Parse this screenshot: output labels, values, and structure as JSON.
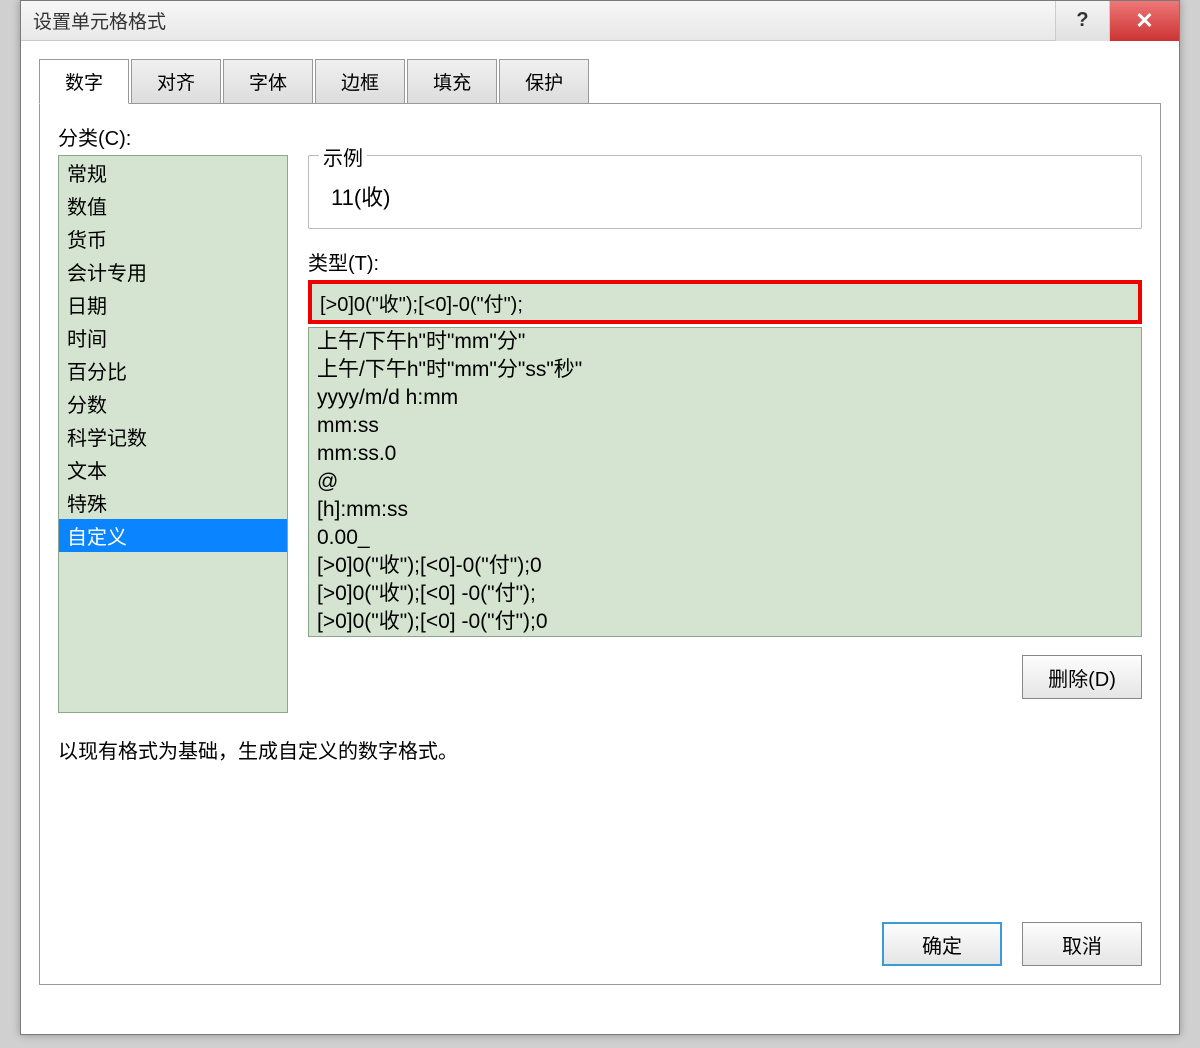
{
  "window": {
    "title": "设置单元格格式",
    "help_icon": "?",
    "close_icon": "✕"
  },
  "tabs": [
    "数字",
    "对齐",
    "字体",
    "边框",
    "填充",
    "保护"
  ],
  "active_tab_index": 0,
  "category_label": "分类(C):",
  "categories": [
    "常规",
    "数值",
    "货币",
    "会计专用",
    "日期",
    "时间",
    "百分比",
    "分数",
    "科学记数",
    "文本",
    "特殊",
    "自定义"
  ],
  "selected_category_index": 11,
  "sample": {
    "legend": "示例",
    "value": "11(收)"
  },
  "type_label": "类型(T):",
  "type_value": "[>0]0(\"收\");[<0]-0(\"付\");",
  "format_list": [
    "上午/下午h\"时\"mm\"分\"",
    "上午/下午h\"时\"mm\"分\"ss\"秒\"",
    "yyyy/m/d h:mm",
    "mm:ss",
    "mm:ss.0",
    "@",
    "[h]:mm:ss",
    "0.00_",
    "[>0]0(\"收\");[<0]-0(\"付\");0",
    "[>0]0(\"收\");[<0] -0(\"付\");",
    "[>0]0(\"收\");[<0] -0(\"付\");0"
  ],
  "buttons": {
    "delete": "删除(D)",
    "ok": "确定",
    "cancel": "取消"
  },
  "hint": "以现有格式为基础，生成自定义的数字格式。"
}
